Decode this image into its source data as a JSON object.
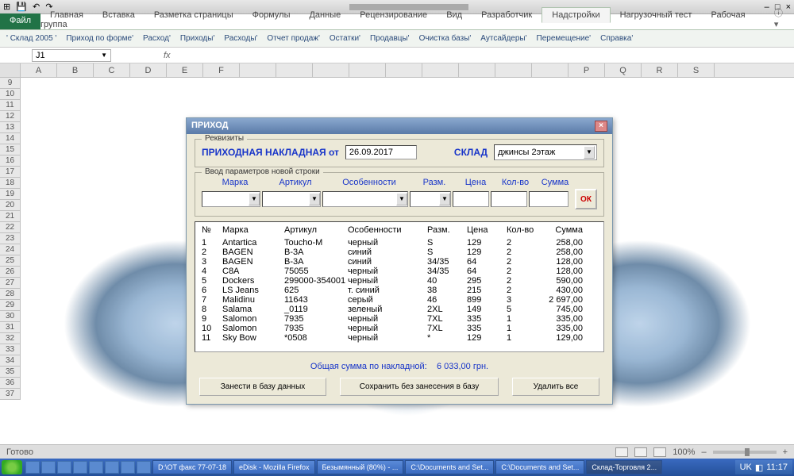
{
  "window_controls": {
    "min": "–",
    "max": "□",
    "close": "×"
  },
  "ribbon": {
    "file": "Файл",
    "tabs": [
      "Главная",
      "Вставка",
      "Разметка страницы",
      "Формулы",
      "Данные",
      "Рецензирование",
      "Вид",
      "Разработчик",
      "Надстройки",
      "Нагрузочный тест",
      "Рабочая группа"
    ],
    "active_index": 8
  },
  "addin_menu": [
    "' Склад 2005 '",
    "Приход по форме'",
    "Расход'",
    "Приходы'",
    "Расходы'",
    "Отчет продаж'",
    "Остатки'",
    "Продавцы'",
    "Очистка базы'",
    "Аутсайдеры'",
    "Перемещение'",
    "Справка'"
  ],
  "namebox": "J1",
  "columns": [
    "A",
    "B",
    "C",
    "D",
    "E",
    "F",
    "",
    "",
    "",
    "",
    "",
    "",
    "",
    "",
    "",
    "P",
    "Q",
    "R",
    "S"
  ],
  "row_start": 9,
  "row_end": 37,
  "dialog": {
    "title": "ПРИХОД",
    "fieldset1": "Реквизиты",
    "doc_label": "ПРИХОДНАЯ НАКЛАДНАЯ  от",
    "date": "26.09.2017",
    "sklad_label": "СКЛАД",
    "sklad_value": "джинсы 2этаж",
    "fieldset2": "Ввод параметров новой строки",
    "param_headers": {
      "marka": "Марка",
      "artikul": "Артикул",
      "osob": "Особенности",
      "razm": "Разм.",
      "cena": "Цена",
      "kol": "Кол-во",
      "summa": "Сумма"
    },
    "ok": "ОК",
    "table_headers": {
      "no": "№",
      "marka": "Марка",
      "artikul": "Артикул",
      "osob": "Особенности",
      "razm": "Разм.",
      "cena": "Цена",
      "kol": "Кол-во",
      "summa": "Сумма"
    },
    "rows": [
      {
        "no": "1",
        "marka": "Antartica",
        "art": "Toucho-M",
        "osob": "черный",
        "razm": "S",
        "cena": "129",
        "kol": "2",
        "sum": "258,00"
      },
      {
        "no": "2",
        "marka": "BAGEN",
        "art": "B-3A",
        "osob": "синий",
        "razm": "S",
        "cena": "129",
        "kol": "2",
        "sum": "258,00"
      },
      {
        "no": "3",
        "marka": "BAGEN",
        "art": "B-3A",
        "osob": "синий",
        "razm": "34/35",
        "cena": "64",
        "kol": "2",
        "sum": "128,00"
      },
      {
        "no": "4",
        "marka": "C8A",
        "art": "75055",
        "osob": "черный",
        "razm": "34/35",
        "cena": "64",
        "kol": "2",
        "sum": "128,00"
      },
      {
        "no": "5",
        "marka": "Dockers",
        "art": "299000-354001",
        "osob": "черный",
        "razm": "40",
        "cena": "295",
        "kol": "2",
        "sum": "590,00"
      },
      {
        "no": "6",
        "marka": "LS Jeans",
        "art": "625",
        "osob": "т. синий",
        "razm": "38",
        "cena": "215",
        "kol": "2",
        "sum": "430,00"
      },
      {
        "no": "7",
        "marka": "Malidinu",
        "art": "11643",
        "osob": "серый",
        "razm": "46",
        "cena": "899",
        "kol": "3",
        "sum": "2 697,00"
      },
      {
        "no": "8",
        "marka": "Salama",
        "art": "_0119",
        "osob": "зеленый",
        "razm": "2XL",
        "cena": "149",
        "kol": "5",
        "sum": "745,00"
      },
      {
        "no": "9",
        "marka": "Salomon",
        "art": "7935",
        "osob": "черный",
        "razm": "7XL",
        "cena": "335",
        "kol": "1",
        "sum": "335,00"
      },
      {
        "no": "10",
        "marka": "Salomon",
        "art": "7935",
        "osob": "черный",
        "razm": "7XL",
        "cena": "335",
        "kol": "1",
        "sum": "335,00"
      },
      {
        "no": "11",
        "marka": "Sky Bow",
        "art": "*0508",
        "osob": "черный",
        "razm": "*",
        "cena": "129",
        "kol": "1",
        "sum": "129,00"
      }
    ],
    "total_label": "Общая сумма по накладной:",
    "total_value": "6 033,00  грн.",
    "btn_save": "Занести в базу данных",
    "btn_keep": "Сохранить  без занесения в базу",
    "btn_del": "Удалить все"
  },
  "statusbar": {
    "ready": "Готово",
    "zoom": "100%",
    "plus": "+",
    "minus": "–"
  },
  "taskbar": {
    "items": [
      "D:\\ОТ факс 77-07-18",
      "eDisk - Mozilla Firefox",
      "Безымянный (80%) - ...",
      "C:\\Documents and Set...",
      "C:\\Documents and Set...",
      "Склад-Торговля 2..."
    ],
    "active_index": 5,
    "clock": "11:17",
    "lang": "UK"
  }
}
